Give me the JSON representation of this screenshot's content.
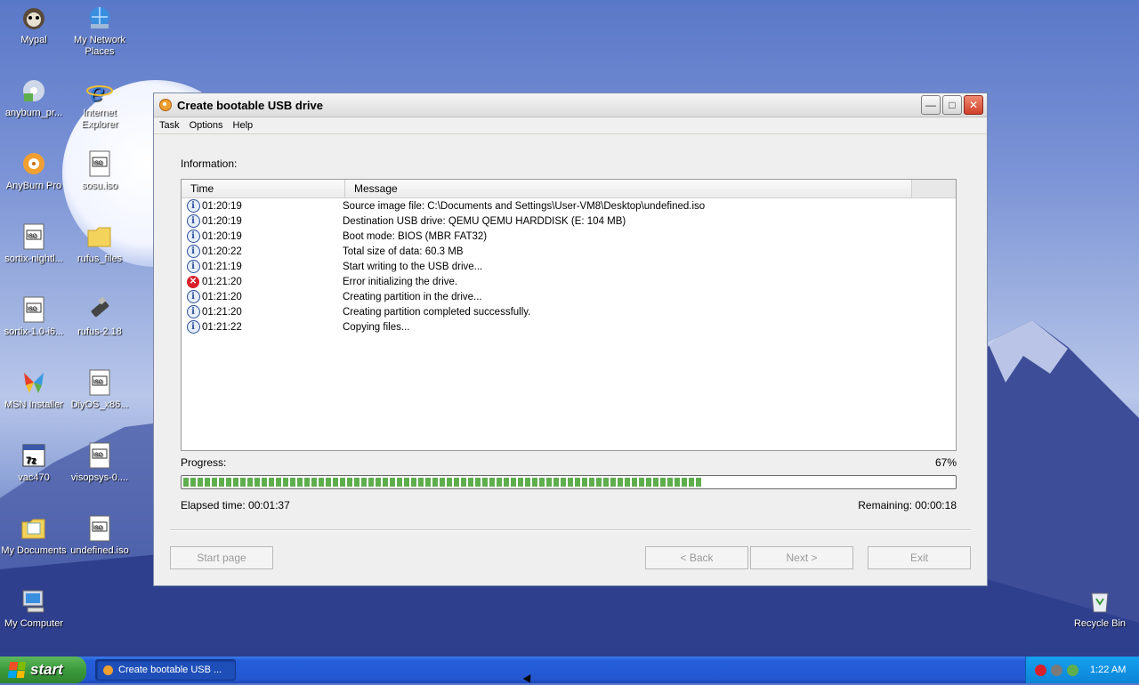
{
  "desktop": {
    "icons": [
      {
        "label": "Mypal"
      },
      {
        "label": "My Network Places"
      },
      {
        "label": "anyburn_pr..."
      },
      {
        "label": "Internet Explorer"
      },
      {
        "label": "AnyBurn Pro"
      },
      {
        "label": "sosu.iso"
      },
      {
        "label": "sortix-nightl..."
      },
      {
        "label": "rufus_files"
      },
      {
        "label": "sortix-1.0-i6..."
      },
      {
        "label": "rufus-2.18"
      },
      {
        "label": "MSN Installer"
      },
      {
        "label": "DiyOS_x86..."
      },
      {
        "label": "vac470"
      },
      {
        "label": "visopsys-0...."
      },
      {
        "label": "My Documents"
      },
      {
        "label": "undefined.iso"
      },
      {
        "label": "My Computer"
      },
      {
        "label": "Recycle Bin"
      }
    ]
  },
  "window": {
    "title": "Create bootable USB drive",
    "menu": [
      "Task",
      "Options",
      "Help"
    ],
    "information_label": "Information:",
    "columns": {
      "time": "Time",
      "message": "Message"
    },
    "log": [
      {
        "type": "info",
        "time": "01:20:19",
        "message": "Source image file: C:\\Documents and Settings\\User-VM8\\Desktop\\undefined.iso"
      },
      {
        "type": "info",
        "time": "01:20:19",
        "message": "Destination USB drive: QEMU QEMU HARDDISK (E:  104 MB)"
      },
      {
        "type": "info",
        "time": "01:20:19",
        "message": "Boot mode: BIOS (MBR FAT32)"
      },
      {
        "type": "info",
        "time": "01:20:22",
        "message": "Total size of data: 60.3 MB"
      },
      {
        "type": "info",
        "time": "01:21:19",
        "message": "Start writing to the USB drive..."
      },
      {
        "type": "error",
        "time": "01:21:20",
        "message": "Error initializing the drive."
      },
      {
        "type": "info",
        "time": "01:21:20",
        "message": "Creating partition in the drive..."
      },
      {
        "type": "info",
        "time": "01:21:20",
        "message": "Creating partition completed successfully."
      },
      {
        "type": "info",
        "time": "01:21:22",
        "message": "Copying files..."
      }
    ],
    "progress_label": "Progress:",
    "progress_percent_text": "67%",
    "progress_value": 0.67,
    "elapsed": "Elapsed time:  00:01:37",
    "remaining": "Remaining:  00:00:18",
    "buttons": {
      "start_page": "Start page",
      "back": "< Back",
      "next": "Next >",
      "exit": "Exit"
    }
  },
  "taskbar": {
    "start_label": "start",
    "task_item": "Create bootable USB ...",
    "clock": "1:22 AM"
  },
  "colors": {
    "taskbar_blue": "#245edb",
    "start_green": "#3c9a3c",
    "progress_green": "#5fae4e",
    "error_red": "#d8202a"
  }
}
